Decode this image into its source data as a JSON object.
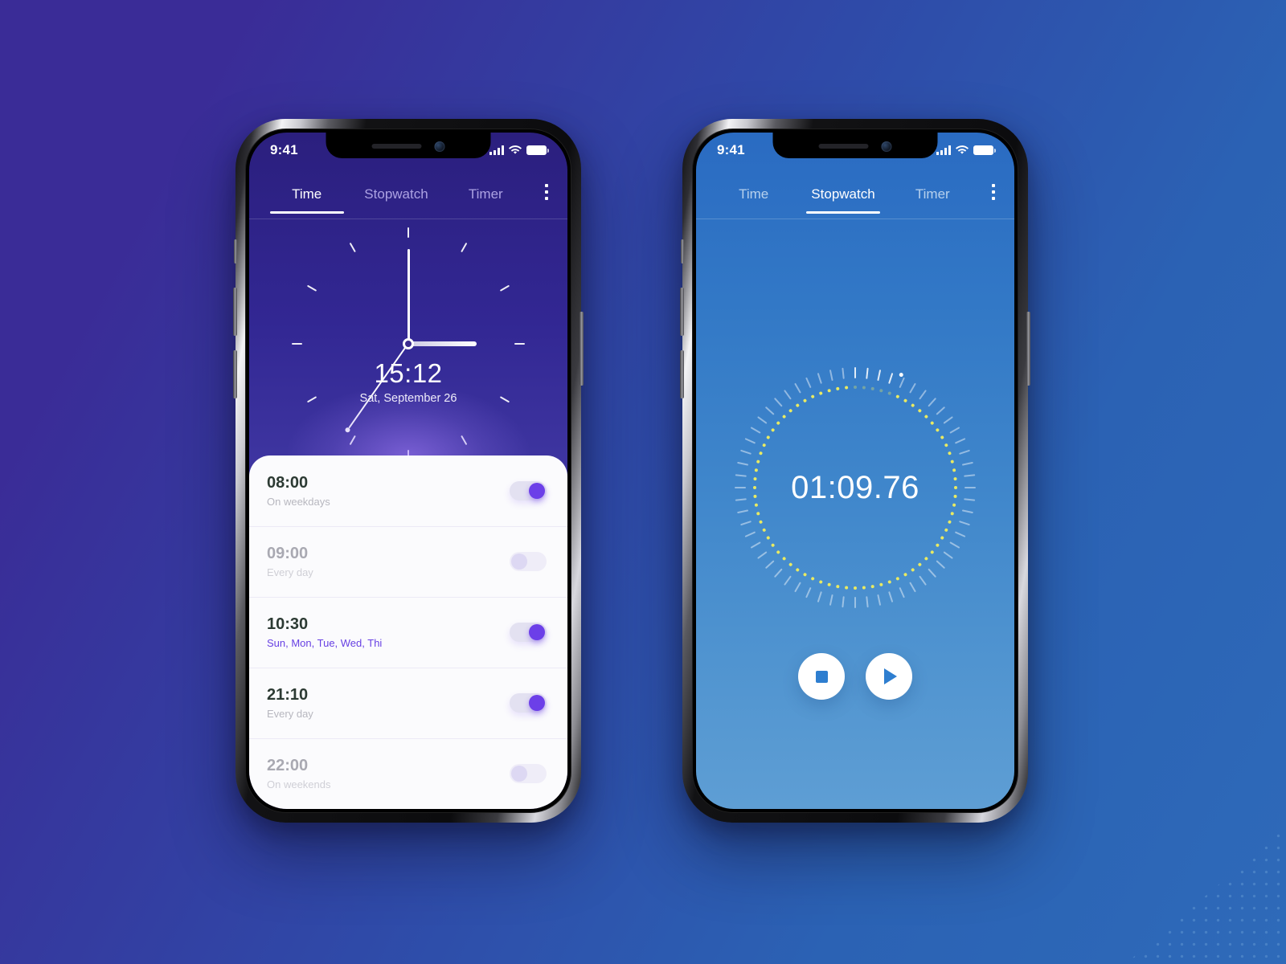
{
  "background": {
    "gradient_from": "#3a2c97",
    "gradient_to": "#2e6ab9",
    "decoration": "dot-triangle"
  },
  "phone_time": {
    "statusbar": {
      "time": "9:41",
      "icons": [
        "signal-icon",
        "wifi-icon",
        "battery-icon"
      ]
    },
    "tabs": [
      {
        "label": "Time",
        "active": true
      },
      {
        "label": "Stopwatch",
        "active": false
      },
      {
        "label": "Timer",
        "active": false
      }
    ],
    "menu_icon": "kebab-menu-icon",
    "clock": {
      "time": "15:12",
      "date": "Sat, September 26",
      "hour_angle": 90,
      "minute_angle": 0,
      "second_angle": 215,
      "screen_gradient_from": "#2b1f7e",
      "screen_gradient_to": "#6a5fbd"
    },
    "alarms": [
      {
        "time": "08:00",
        "repeat": "On weekdays",
        "enabled": true,
        "accent": false
      },
      {
        "time": "09:00",
        "repeat": "Every day",
        "enabled": false,
        "accent": false
      },
      {
        "time": "10:30",
        "repeat": "Sun, Mon, Tue, Wed, Thi",
        "enabled": true,
        "accent": true
      },
      {
        "time": "21:10",
        "repeat": "Every day",
        "enabled": true,
        "accent": false
      },
      {
        "time": "22:00",
        "repeat": "On weekends",
        "enabled": false,
        "accent": false
      }
    ],
    "toggle_on_color": "#6c3fe8",
    "toggle_track_color": "#e3e1f1"
  },
  "phone_stopwatch": {
    "statusbar": {
      "time": "9:41",
      "icons": [
        "signal-icon",
        "wifi-icon",
        "battery-icon"
      ]
    },
    "tabs": [
      {
        "label": "Time",
        "active": false
      },
      {
        "label": "Stopwatch",
        "active": true
      },
      {
        "label": "Timer",
        "active": false
      }
    ],
    "menu_icon": "kebab-menu-icon",
    "stopwatch": {
      "elapsed": "01:09.76",
      "progress_angle": 22,
      "tick_color": "#ffffff",
      "dot_color": "#e9ea62",
      "screen_gradient_from": "#2a6bc2",
      "screen_gradient_to": "#5e9ed4"
    },
    "controls": [
      {
        "name": "stop-button",
        "icon": "stop-icon"
      },
      {
        "name": "play-button",
        "icon": "play-icon"
      }
    ],
    "accent_color": "#2e7ed0"
  }
}
